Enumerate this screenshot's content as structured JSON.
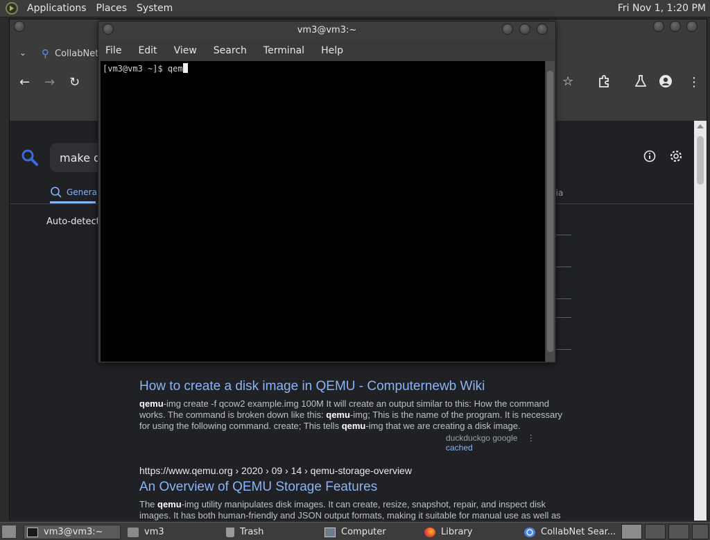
{
  "top_panel": {
    "menus": [
      "Applications",
      "Places",
      "System"
    ],
    "clock": "Fri Nov  1,  1:20 PM"
  },
  "browser": {
    "tab_label": "CollabNet",
    "search_query": "make qe",
    "category_general": "General",
    "category_media": "dia",
    "autodetect": "Auto-detect (",
    "results": [
      {
        "title": "How to create a disk image in QEMU - Computernewb Wiki",
        "snippet_html": "<b>qemu</b>-img create -f qcow2 example.img 100M It will create an output similar to this: How the command works. The command is broken down like this: <b>qemu</b>-img; This is the name of the program. It is necessary for using the following command. create; This tells <b>qemu</b>-img that we are creating a disk image.",
        "engines": "duckduckgo  google",
        "cached": "cached"
      },
      {
        "url": "https://www.qemu.org  › 2020 › 09 › 14 › qemu-storage-overview",
        "title": "An Overview of QEMU Storage Features",
        "snippet_html": "The <b>qemu</b>-img utility manipulates disk images. It can create, resize, snapshot, repair, and inspect disk images. It has both human-friendly and JSON output formats, making it suitable for manual use as well as scripting. <b>qemu</b>-storage-daemon exposes <b>QEMU</b>'s storage functionality in a server process without running"
      }
    ]
  },
  "terminal": {
    "title": "vm3@vm3:~",
    "menu": [
      "File",
      "Edit",
      "View",
      "Search",
      "Terminal",
      "Help"
    ],
    "prompt": "[vm3@vm3 ~]$ qem"
  },
  "taskbar": {
    "items": [
      {
        "label": "vm3@vm3:~",
        "icon": "terminal-icon"
      },
      {
        "label": "vm3",
        "icon": "folder-icon"
      },
      {
        "label": "Trash",
        "icon": "trash-icon"
      },
      {
        "label": "Computer",
        "icon": "computer-icon"
      },
      {
        "label": "Library",
        "icon": "firefox-icon"
      },
      {
        "label": "CollabNet Sear...",
        "icon": "chrome-icon"
      }
    ]
  }
}
